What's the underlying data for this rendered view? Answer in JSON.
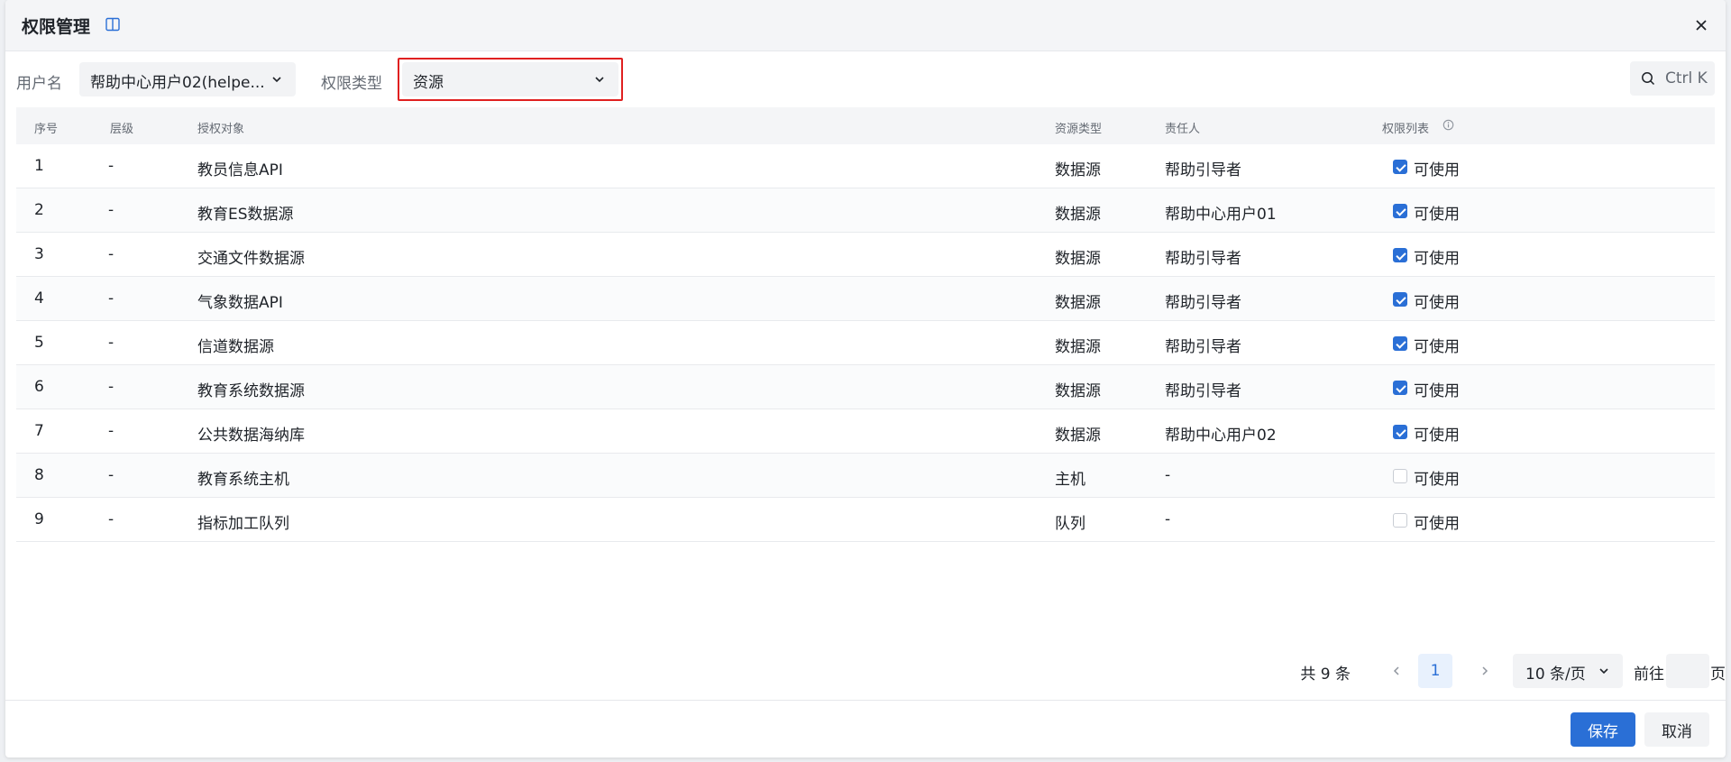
{
  "dialog": {
    "title": "权限管理"
  },
  "filters": {
    "user_label": "用户名",
    "user_value": "帮助中心用户02(helpe...",
    "type_label": "权限类型",
    "type_value": "资源",
    "search_placeholder": "Ctrl K",
    "highlight_color": "#e02020"
  },
  "table": {
    "headers": [
      "序号",
      "层级",
      "授权对象",
      "资源类型",
      "责任人",
      "权限列表"
    ],
    "rows": [
      {
        "no": "1",
        "level": "-",
        "object": "教员信息API",
        "type": "数据源",
        "owner": "帮助引导者",
        "perm": "可使用",
        "checked": true
      },
      {
        "no": "2",
        "level": "-",
        "object": "教育ES数据源",
        "type": "数据源",
        "owner": "帮助中心用户01",
        "perm": "可使用",
        "checked": true
      },
      {
        "no": "3",
        "level": "-",
        "object": "交通文件数据源",
        "type": "数据源",
        "owner": "帮助引导者",
        "perm": "可使用",
        "checked": true
      },
      {
        "no": "4",
        "level": "-",
        "object": "气象数据API",
        "type": "数据源",
        "owner": "帮助引导者",
        "perm": "可使用",
        "checked": true
      },
      {
        "no": "5",
        "level": "-",
        "object": "信道数据源",
        "type": "数据源",
        "owner": "帮助引导者",
        "perm": "可使用",
        "checked": true
      },
      {
        "no": "6",
        "level": "-",
        "object": "教育系统数据源",
        "type": "数据源",
        "owner": "帮助引导者",
        "perm": "可使用",
        "checked": true
      },
      {
        "no": "7",
        "level": "-",
        "object": "公共数据海纳库",
        "type": "数据源",
        "owner": "帮助中心用户02",
        "perm": "可使用",
        "checked": true
      },
      {
        "no": "8",
        "level": "-",
        "object": "教育系统主机",
        "type": "主机",
        "owner": "-",
        "perm": "可使用",
        "checked": false
      },
      {
        "no": "9",
        "level": "-",
        "object": "指标加工队列",
        "type": "队列",
        "owner": "-",
        "perm": "可使用",
        "checked": false
      }
    ]
  },
  "pagination": {
    "total": "共 9 条",
    "current": "1",
    "page_size": "10 条/页",
    "goto_label": "前往",
    "page_suffix": "页"
  },
  "footer": {
    "save": "保存",
    "cancel": "取消"
  },
  "colors": {
    "primary": "#2a6fd6",
    "checkbox_checked": "#2a6fd6"
  }
}
